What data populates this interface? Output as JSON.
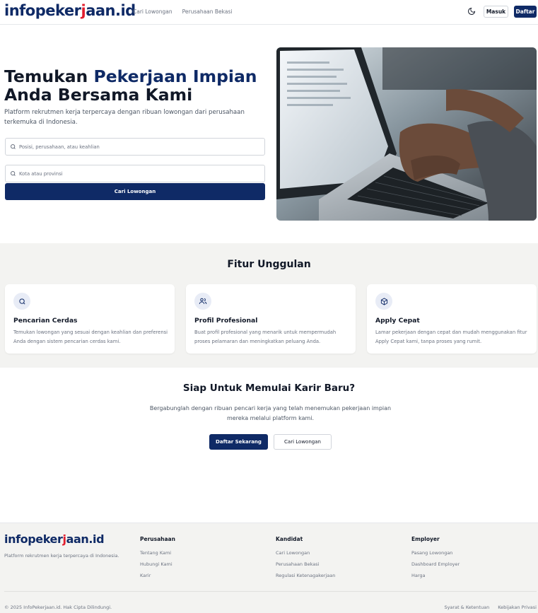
{
  "brand": {
    "part1": "info",
    "part2": "peker",
    "part3": "j",
    "part4": "aan.id"
  },
  "nav": {
    "items": [
      "Cari Lowongan",
      "Perusahaan Bekasi"
    ]
  },
  "header": {
    "login": "Masuk",
    "register": "Daftar"
  },
  "hero": {
    "title_line1_plain": "Temukan ",
    "title_line1_accent": "Pekerjaan Impian",
    "title_line2": "Anda Bersama Kami",
    "subtitle": "Platform rekrutmen kerja terpercaya dengan ribuan lowongan dari perusahaan terkemuka di Indonesia.",
    "search_placeholder": "Posisi, perusahaan, atau keahlian",
    "location_placeholder": "Kota atau provinsi",
    "search_button": "Cari Lowongan"
  },
  "features": {
    "title": "Fitur Unggulan",
    "items": [
      {
        "icon": "search-icon",
        "title": "Pencarian Cerdas",
        "desc": "Temukan lowongan yang sesuai dengan keahlian dan preferensi Anda dengan sistem pencarian cerdas kami."
      },
      {
        "icon": "users-icon",
        "title": "Profil Profesional",
        "desc": "Buat profil profesional yang menarik untuk mempermudah proses pelamaran dan meningkatkan peluang Anda."
      },
      {
        "icon": "box-icon",
        "title": "Apply Cepat",
        "desc": "Lamar pekerjaan dengan cepat dan mudah menggunakan fitur Apply Cepat kami, tanpa proses yang rumit."
      }
    ]
  },
  "cta": {
    "title": "Siap Untuk Memulai Karir Baru?",
    "subtitle": "Bergabunglah dengan ribuan pencari kerja yang telah menemukan pekerjaan impian mereka melalui platform kami.",
    "primary": "Daftar Sekarang",
    "secondary": "Cari Lowongan"
  },
  "footer": {
    "tagline": "Platform rekrutmen kerja terpercaya di Indonesia.",
    "columns": [
      {
        "title": "Perusahaan",
        "links": [
          "Tentang Kami",
          "Hubungi Kami",
          "Karir"
        ]
      },
      {
        "title": "Kandidat",
        "links": [
          "Cari Lowongan",
          "Perusahaan Bekasi",
          "Regulasi Ketenagakerjaan"
        ]
      },
      {
        "title": "Employer",
        "links": [
          "Pasang Lowongan",
          "Dashboard Employer",
          "Harga"
        ]
      }
    ],
    "copyright": "© 2025 InfoPekerjaan.id. Hak Cipta Dilindungi.",
    "legal": [
      "Syarat & Ketentuan",
      "Kebijakan Privasi"
    ]
  },
  "colors": {
    "primary": "#0f2a66",
    "accent": "#e11d2e",
    "section_bg": "#f3f3f1"
  }
}
